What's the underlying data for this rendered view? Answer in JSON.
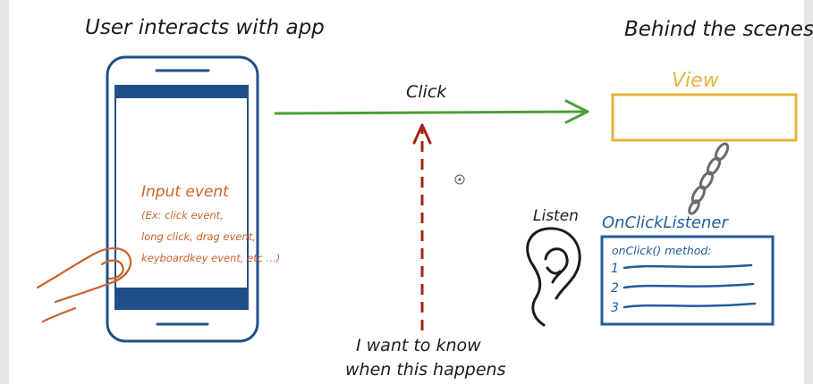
{
  "headings": {
    "left": "User interacts with app",
    "right": "Behind the scenes"
  },
  "phone": {
    "input_title": "Input event",
    "input_lines": [
      "(Ex: click event,",
      "long click, drag event,",
      "keyboardkey event, etc ...)"
    ]
  },
  "arrows": {
    "click_label": "Click",
    "question_lines": [
      "I want to know",
      "when this happens"
    ]
  },
  "view": {
    "label": "View"
  },
  "listener": {
    "listen_label": "Listen",
    "title": "OnClickListener",
    "method_label": "onClick() method:",
    "steps": [
      "1",
      "2",
      "3"
    ]
  },
  "colors": {
    "ink": "#1b1b1b",
    "phone": "#1f4f8a",
    "input": "#c8622a",
    "arrow_green": "#4aa035",
    "arrow_red": "#a32318",
    "view": "#e3b53a",
    "listener": "#1f5d99"
  }
}
